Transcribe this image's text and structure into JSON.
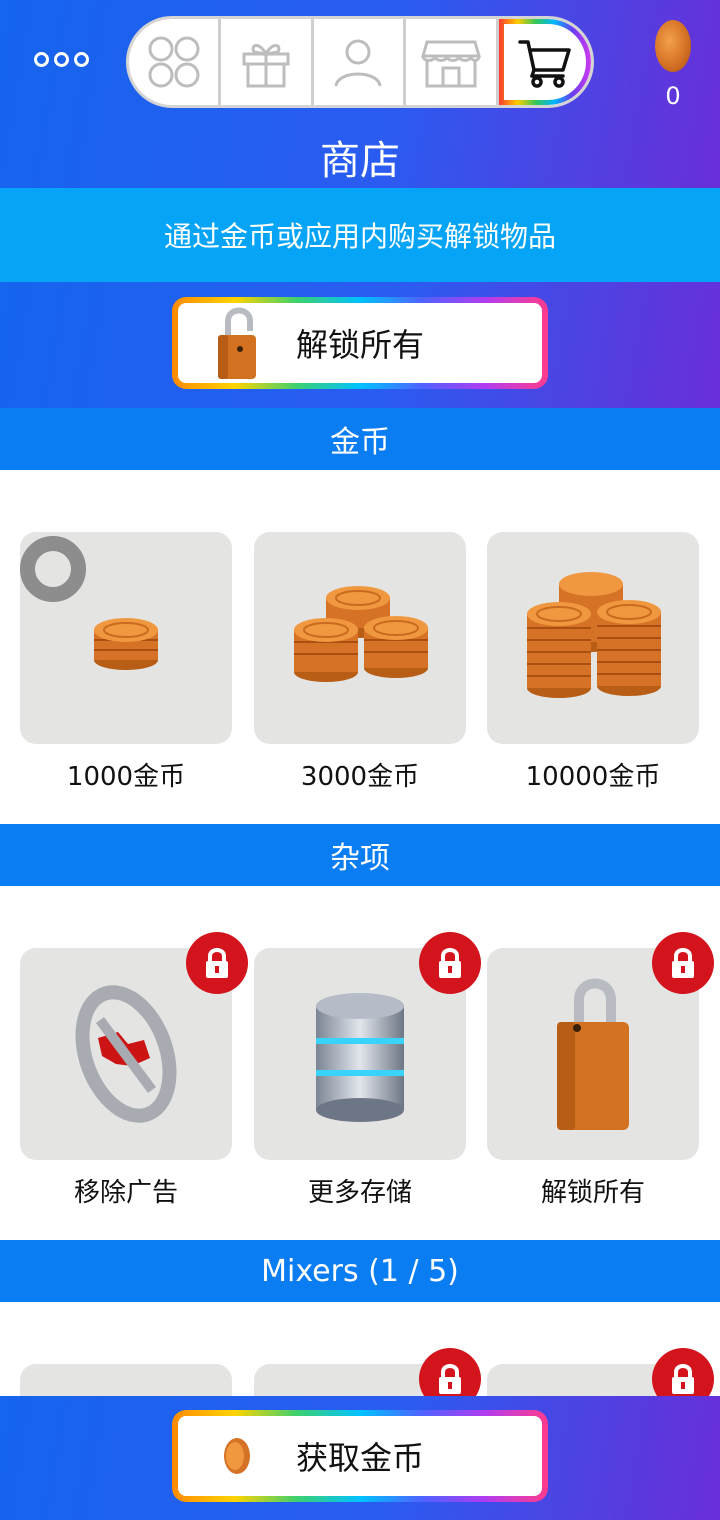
{
  "header": {
    "menu_icon": "more-dots-icon",
    "nav_tabs": [
      {
        "icon": "grid-icon",
        "active": false
      },
      {
        "icon": "gift-icon",
        "active": false
      },
      {
        "icon": "profile-icon",
        "active": false
      },
      {
        "icon": "store-icon",
        "active": false
      },
      {
        "icon": "cart-icon",
        "active": true
      }
    ],
    "coin_balance": "0",
    "title": "商店"
  },
  "banner": {
    "text": "通过金币或应用内购买解锁物品"
  },
  "unlock_all_button": {
    "label": "解锁所有",
    "icon": "padlock-icon"
  },
  "sections": {
    "coins": {
      "title": "金币",
      "items": [
        {
          "label": "1000金币",
          "icon": "coin-stack-small-icon"
        },
        {
          "label": "3000金币",
          "icon": "coin-stack-medium-icon"
        },
        {
          "label": "10000金币",
          "icon": "coin-stack-large-icon"
        }
      ]
    },
    "misc": {
      "title": "杂项",
      "items": [
        {
          "label": "移除广告",
          "icon": "no-ads-icon",
          "locked": true
        },
        {
          "label": "更多存储",
          "icon": "database-icon",
          "locked": true
        },
        {
          "label": "解锁所有",
          "icon": "padlock-icon",
          "locked": true
        }
      ]
    },
    "mixers": {
      "title": "Mixers (1 / 5)"
    }
  },
  "get_coins_button": {
    "label": "获取金币",
    "icon": "coin-icon"
  },
  "colors": {
    "header_gradient_start": "#1565ee",
    "header_gradient_end": "#6a2ed8",
    "banner": "#05a4f6",
    "section_header": "#0a7df3",
    "lock_badge": "#d3141c",
    "coin": "#d57225"
  }
}
